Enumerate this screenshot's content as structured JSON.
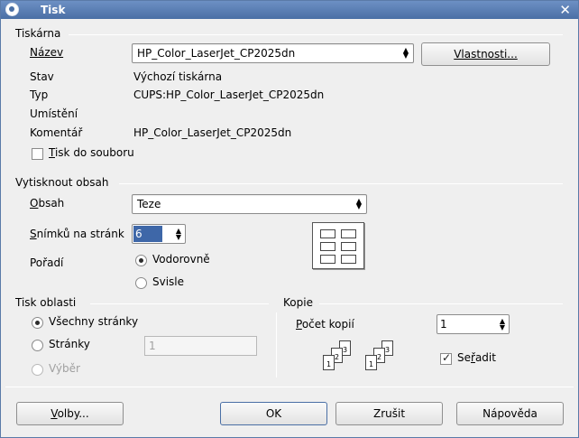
{
  "window": {
    "title": "Tisk",
    "icon": "app-icon",
    "close_icon": "close-icon"
  },
  "printer": {
    "section_title": "Tiskárna",
    "name_label": "Název",
    "name_value": "HP_Color_LaserJet_CP2025dn",
    "properties_button": "Vlastnosti...",
    "status_label": "Stav",
    "status_value": "Výchozí tiskárna",
    "type_label": "Typ",
    "type_value": "CUPS:HP_Color_LaserJet_CP2025dn",
    "location_label": "Umístění",
    "location_value": "",
    "comment_label": "Komentář",
    "comment_value": "HP_Color_LaserJet_CP2025dn",
    "print_to_file_label": "Tisk do souboru",
    "print_to_file_checked": false
  },
  "content": {
    "section_title": "Vytisknout obsah",
    "content_label": "Obsah",
    "content_value": "Teze",
    "slides_per_page_label": "Snímků na stránk",
    "slides_per_page_value": "6",
    "order_label": "Pořadí",
    "order_options": [
      {
        "label": "Vodorovně",
        "checked": true
      },
      {
        "label": "Svisle",
        "checked": false
      }
    ]
  },
  "print_range": {
    "section_title": "Tisk oblasti",
    "options": [
      {
        "label": "Všechny stránky",
        "checked": true,
        "disabled": false
      },
      {
        "label": "Stránky",
        "checked": false,
        "disabled": false
      },
      {
        "label": "Výběr",
        "checked": false,
        "disabled": true
      }
    ],
    "pages_value": "1"
  },
  "copies": {
    "section_title": "Kopie",
    "count_label": "Počet kopií",
    "count_value": "1",
    "collate_label": "Seřadit",
    "collate_checked": true
  },
  "buttons": {
    "options": "Volby...",
    "ok": "OK",
    "cancel": "Zrušit",
    "help": "Nápověda"
  }
}
